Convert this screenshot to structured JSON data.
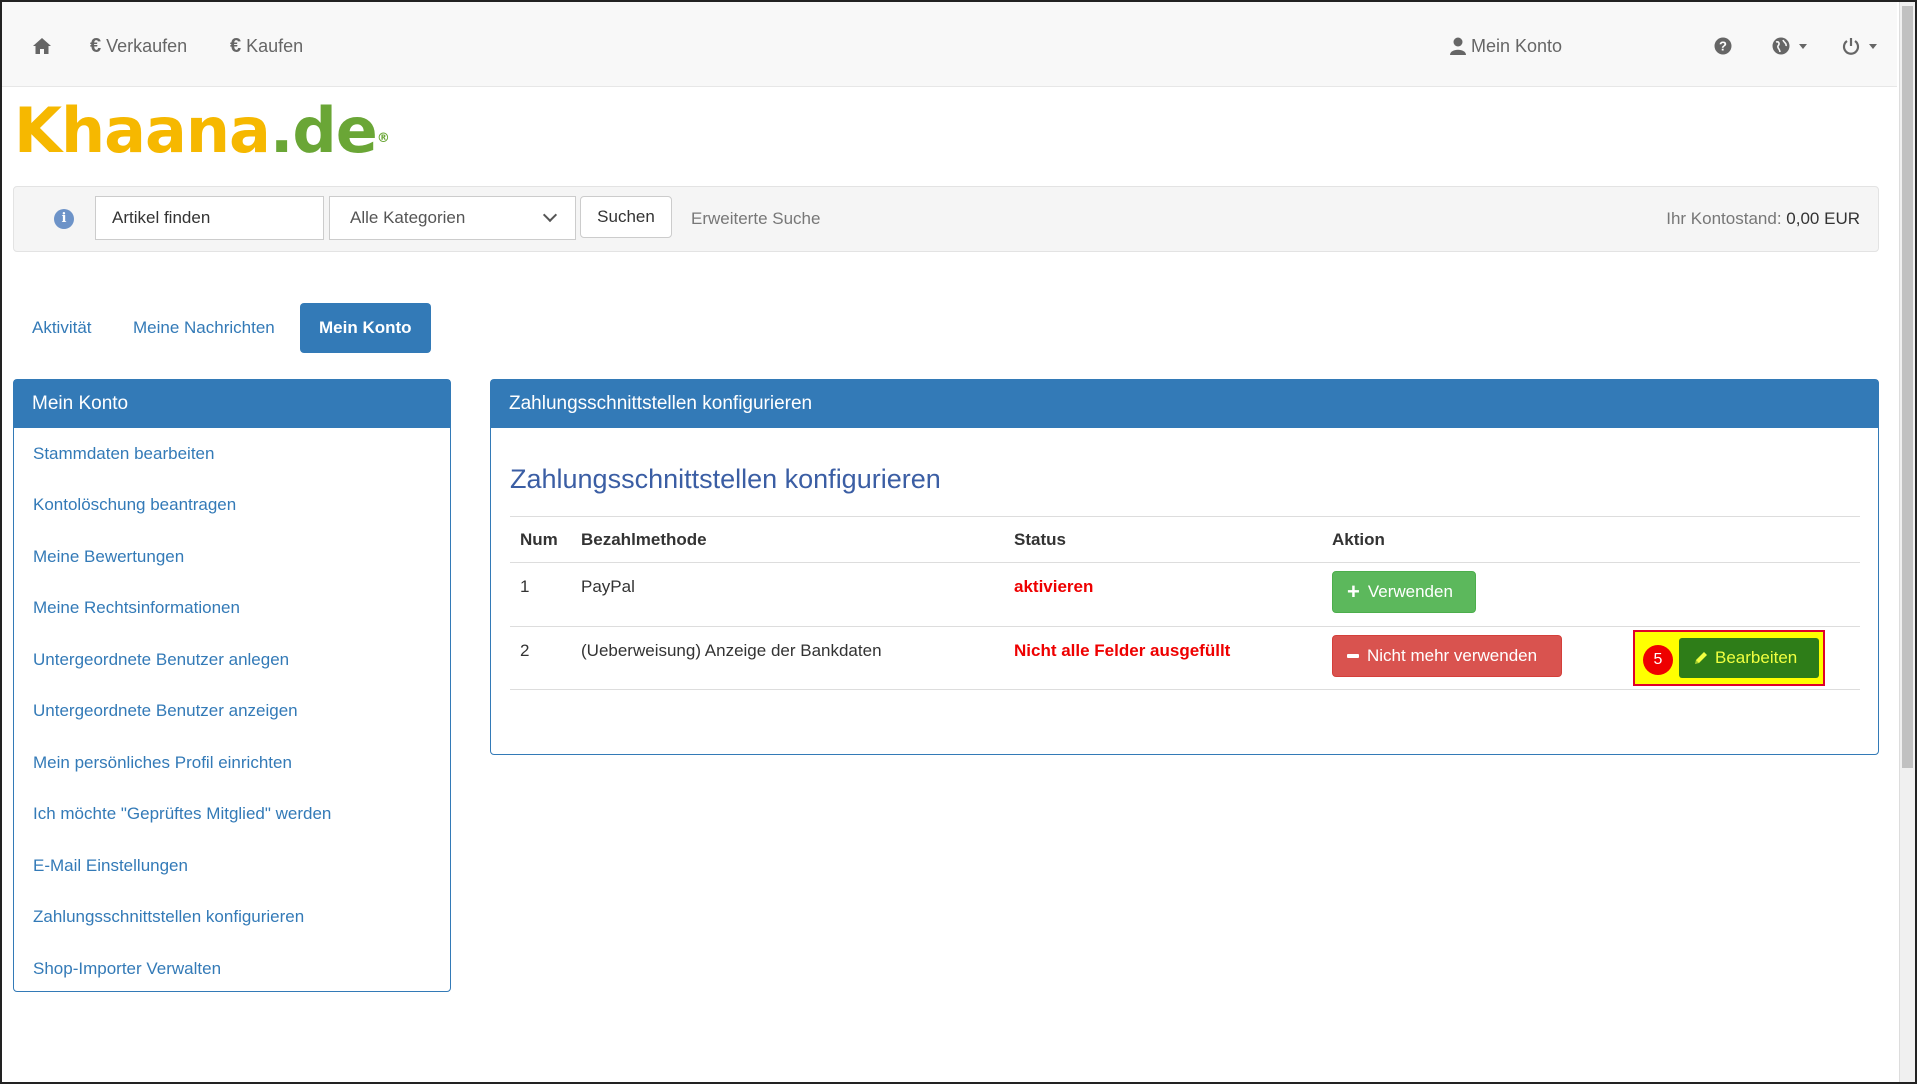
{
  "navbar": {
    "home_icon": "home-icon",
    "sell": "Verkaufen",
    "buy": "Kaufen",
    "currency_symbol": "€",
    "account": "Mein Konto",
    "help_icon": "question-circle-icon",
    "language_icon": "globe-icon",
    "power_icon": "power-icon"
  },
  "logo": {
    "part1": "Khaana",
    "part2": ".de",
    "mark": "®"
  },
  "search": {
    "info_icon": "info-icon",
    "input_value": "Artikel finden",
    "category_selected": "Alle Kategorien",
    "button": "Suchen",
    "advanced": "Erweiterte Suche",
    "balance_label": "Ihr Kontostand:",
    "balance_value": "0,00 EUR"
  },
  "tabs": [
    {
      "label": "Aktivität"
    },
    {
      "label": "Meine Nachrichten"
    },
    {
      "label": "Mein Konto",
      "active": true
    }
  ],
  "sidebar": {
    "title": "Mein Konto",
    "items": [
      {
        "label": "Stammdaten bearbeiten"
      },
      {
        "label": "Kontolöschung beantragen"
      },
      {
        "label": "Meine Bewertungen"
      },
      {
        "label": "Meine Rechtsinformationen"
      },
      {
        "label": "Untergeordnete Benutzer anlegen"
      },
      {
        "label": "Untergeordnete Benutzer anzeigen"
      },
      {
        "label": "Mein persönliches Profil einrichten"
      },
      {
        "label": "Ich möchte \"Geprüftes Mitglied\" werden"
      },
      {
        "label": "E-Mail Einstellungen"
      },
      {
        "label": "Zahlungsschnittstellen konfigurieren"
      },
      {
        "label": "Shop-Importer Verwalten"
      }
    ]
  },
  "main": {
    "panel_title": "Zahlungsschnittstellen konfigurieren",
    "heading": "Zahlungsschnittstellen konfigurieren",
    "columns": [
      "Num",
      "Bezahlmethode",
      "Status",
      "Aktion"
    ],
    "rows": [
      {
        "num": "1",
        "method": "PayPal",
        "status": "aktivieren",
        "action": "Verwenden"
      },
      {
        "num": "2",
        "method": "(Ueberweisung) Anzeige der Bankdaten",
        "status": "Nicht alle Felder ausgefüllt",
        "action": "Nicht mehr verwenden",
        "edit": "Bearbeiten"
      }
    ],
    "step_badge": "5"
  },
  "colors": {
    "primary": "#337ab7",
    "success": "#5cb85c",
    "danger": "#d9534f",
    "status_red": "#ee0000",
    "highlight": "#ffff00"
  }
}
